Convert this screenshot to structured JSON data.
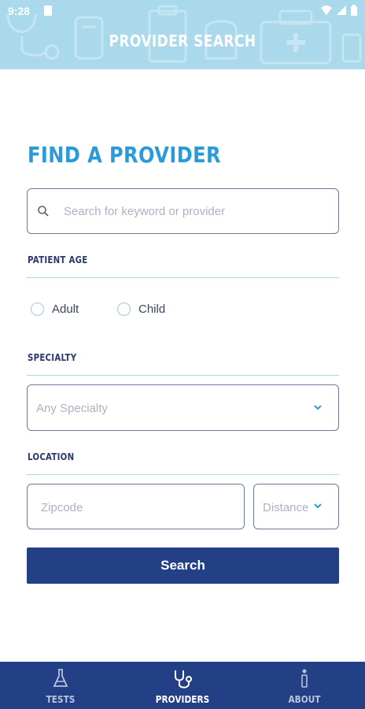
{
  "status_bar": {
    "time": "9:28"
  },
  "header": {
    "title": "PROVIDER SEARCH"
  },
  "main": {
    "heading": "FIND A PROVIDER",
    "search": {
      "placeholder": "Search for keyword or provider",
      "value": ""
    },
    "patient_age": {
      "label": "PATIENT AGE",
      "options": [
        {
          "label": "Adult",
          "selected": false
        },
        {
          "label": "Child",
          "selected": false
        }
      ]
    },
    "specialty": {
      "label": "SPECIALTY",
      "selected": "Any Specialty"
    },
    "location": {
      "label": "LOCATION",
      "zip_placeholder": "Zipcode",
      "distance_selected": "Distance"
    },
    "search_button": "Search"
  },
  "bottom_nav": {
    "items": [
      {
        "label": "TESTS",
        "icon": "flask-icon",
        "active": false
      },
      {
        "label": "PROVIDERS",
        "icon": "stethoscope-icon",
        "active": true
      },
      {
        "label": "ABOUT",
        "icon": "info-icon",
        "active": false
      }
    ]
  },
  "colors": {
    "header_bg": "#a9d9ea",
    "heading": "#2a9ad8",
    "primary": "#233f85",
    "divider": "#a9d9ea"
  }
}
